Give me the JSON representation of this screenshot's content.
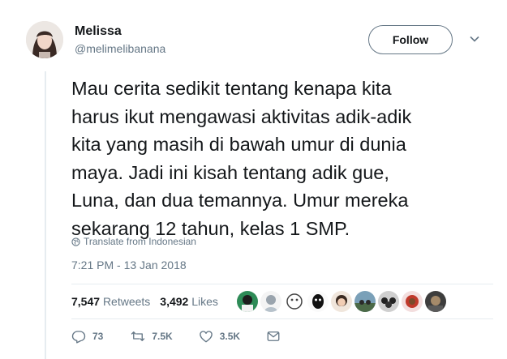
{
  "author": {
    "name": "Melissa",
    "handle": "@melimelibanana",
    "follow_label": "Follow"
  },
  "tweet": {
    "text": "Mau cerita sedikit tentang kenapa kita\nharus ikut mengawasi aktivitas adik-adik\nkita yang masih di bawah umur di dunia\nmaya. Jadi ini kisah tentang adik gue,\nLuna, dan dua temannya. Umur mereka\nsekarang 12 tahun, kelas 1 SMP.",
    "translate_label": "Translate from Indonesian",
    "timestamp": "7:21 PM - 13 Jan 2018"
  },
  "stats": {
    "retweets_count": "7,547",
    "retweets_label": "Retweets",
    "likes_count": "3,492",
    "likes_label": "Likes"
  },
  "actions": {
    "reply_count": "73",
    "retweet_count": "7.5K",
    "like_count": "3.5K"
  },
  "icons": [
    "avatar",
    "chevron-down-icon",
    "globe-icon",
    "reply-icon",
    "retweet-icon",
    "heart-icon",
    "message-icon"
  ],
  "colors": {
    "text": "#14171a",
    "muted": "#657786",
    "border": "#e6ecf0"
  }
}
